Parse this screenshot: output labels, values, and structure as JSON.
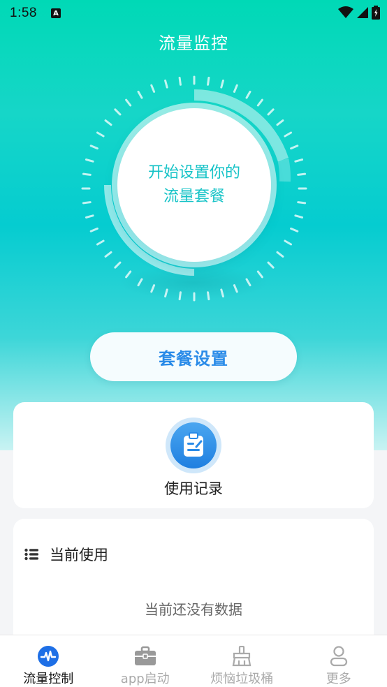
{
  "status_bar": {
    "time": "1:58",
    "app_icon_letter": "A"
  },
  "header": {
    "title": "流量监控"
  },
  "dial": {
    "line1": "开始设置你的",
    "line2": "流量套餐"
  },
  "plan_button": {
    "label": "套餐设置"
  },
  "usage_card": {
    "label": "使用记录"
  },
  "current_card": {
    "title": "当前使用",
    "empty": "当前还没有数据"
  },
  "tabbar": {
    "items": [
      {
        "label": "流量控制",
        "icon": "pulse-icon",
        "active": true
      },
      {
        "label": "app启动",
        "icon": "briefcase-icon",
        "active": false
      },
      {
        "label": "烦恼垃圾桶",
        "icon": "broom-icon",
        "active": false
      },
      {
        "label": "更多",
        "icon": "person-icon",
        "active": false
      }
    ]
  },
  "colors": {
    "accent": "#16c3c7",
    "blue": "#2a8be8",
    "hero_top": "#00d9b6"
  }
}
